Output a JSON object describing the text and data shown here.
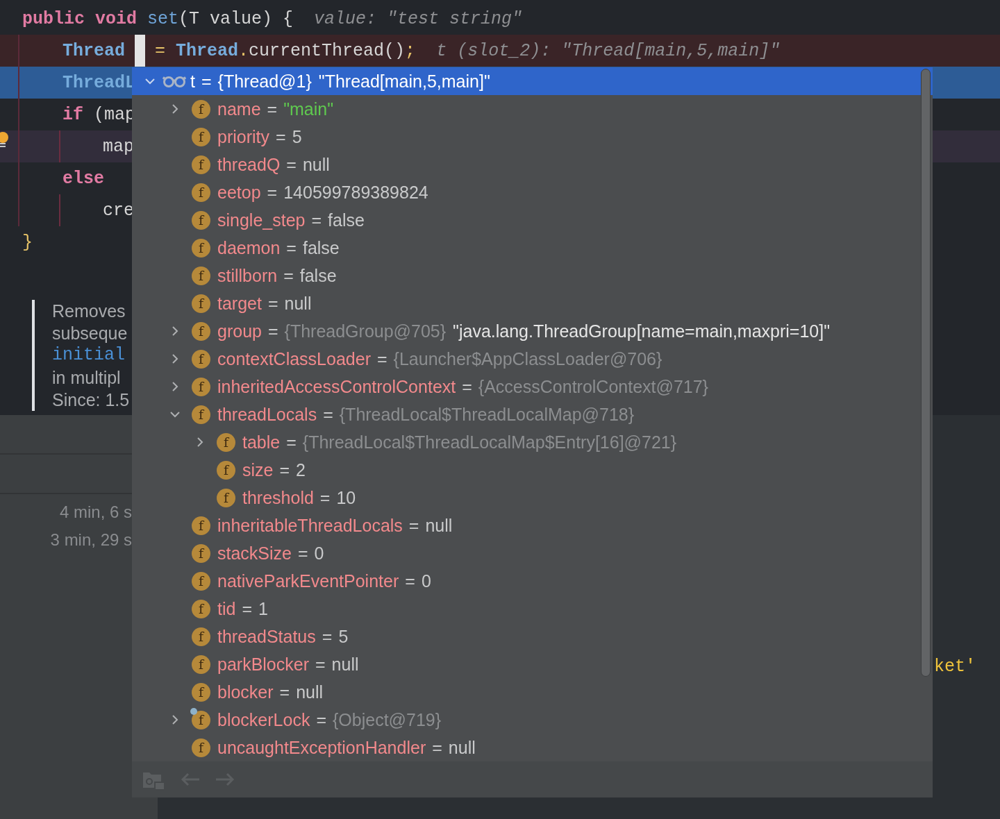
{
  "editor": {
    "lines": [
      {
        "kind": "normal",
        "bulb": false,
        "tokens": [
          {
            "kind": "keyword",
            "text": "public void "
          },
          {
            "kind": "method",
            "text": "set"
          },
          {
            "kind": "plain",
            "text": "(T value) {"
          },
          {
            "kind": "hint",
            "text": "value: \"test string\""
          }
        ],
        "children": [
          {
            "kind": "error",
            "bulb": false,
            "tokens": [
              {
                "kind": "type",
                "text": "Thread"
              },
              {
                "kind": "caret"
              },
              {
                "kind": "punct",
                "text": "= "
              },
              {
                "kind": "type",
                "text": "Thread"
              },
              {
                "kind": "punct",
                "text": "."
              },
              {
                "kind": "plain",
                "text": "currentThread()"
              },
              {
                "kind": "punct",
                "text": ";"
              },
              {
                "kind": "hint",
                "text": "t (slot_2): \"Thread[main,5,main]\""
              }
            ]
          },
          {
            "kind": "current",
            "bulb": false,
            "tokens": [
              {
                "kind": "type",
                "text": "ThreadL"
              }
            ]
          },
          {
            "kind": "normal",
            "bulb": false,
            "tokens": [
              {
                "kind": "keyword",
                "text": "if "
              },
              {
                "kind": "plain",
                "text": "(map"
              }
            ],
            "children": [
              {
                "kind": "highlight",
                "bulb": true,
                "tokens": [
                  {
                    "kind": "plain",
                    "text": "map"
                  }
                ]
              }
            ]
          },
          {
            "kind": "normal",
            "bulb": false,
            "tokens": [
              {
                "kind": "keyword",
                "text": "else"
              }
            ],
            "children": [
              {
                "kind": "normal",
                "bulb": false,
                "tokens": [
                  {
                    "kind": "plain",
                    "text": "cre"
                  }
                ]
              }
            ]
          }
        ]
      },
      {
        "kind": "normal",
        "bulb": false,
        "tokens": [
          {
            "kind": "punct",
            "text": "}"
          }
        ]
      }
    ]
  },
  "doc": {
    "lines": [
      {
        "kind": "text",
        "text": "Removes"
      },
      {
        "kind": "text",
        "text": "subseque"
      },
      {
        "kind": "code",
        "text": "initial"
      },
      {
        "kind": "text",
        "text": "in multipl"
      },
      {
        "kind": "text",
        "text": "Since: 1.5"
      }
    ]
  },
  "panel": {
    "rows": [
      "4 min, 6 s",
      "3 min, 29 s"
    ]
  },
  "right_code": {
    "text": "ket'"
  },
  "popup": {
    "root": {
      "name": "t",
      "op": "=",
      "ref": "{Thread@1}",
      "value": "\"Thread[main,5,main]\"",
      "kind": "watch",
      "selected": true,
      "expandable": true,
      "expanded": true,
      "pinned": false,
      "children": [
        {
          "icon": "f",
          "name": "name",
          "op": "=",
          "value": "\"main\"",
          "kind": "string",
          "selected": false,
          "expandable": true,
          "expanded": false,
          "pinned": false
        },
        {
          "icon": "f",
          "name": "priority",
          "op": "=",
          "value": "5",
          "kind": "primitive",
          "selected": false,
          "expandable": false,
          "expanded": false,
          "pinned": false
        },
        {
          "icon": "f",
          "name": "threadQ",
          "op": "=",
          "value": "null",
          "kind": "primitive",
          "selected": false,
          "expandable": false,
          "expanded": false,
          "pinned": false
        },
        {
          "icon": "f",
          "name": "eetop",
          "op": "=",
          "value": "140599789389824",
          "kind": "primitive",
          "selected": false,
          "expandable": false,
          "expanded": false,
          "pinned": false
        },
        {
          "icon": "f",
          "name": "single_step",
          "op": "=",
          "value": "false",
          "kind": "primitive",
          "selected": false,
          "expandable": false,
          "expanded": false,
          "pinned": false
        },
        {
          "icon": "f",
          "name": "daemon",
          "op": "=",
          "value": "false",
          "kind": "primitive",
          "selected": false,
          "expandable": false,
          "expanded": false,
          "pinned": false
        },
        {
          "icon": "f",
          "name": "stillborn",
          "op": "=",
          "value": "false",
          "kind": "primitive",
          "selected": false,
          "expandable": false,
          "expanded": false,
          "pinned": false
        },
        {
          "icon": "f",
          "name": "target",
          "op": "=",
          "value": "null",
          "kind": "primitive",
          "selected": false,
          "expandable": false,
          "expanded": false,
          "pinned": false
        },
        {
          "icon": "f",
          "name": "group",
          "op": "=",
          "ref": "{ThreadGroup@705}",
          "value": "\"java.lang.ThreadGroup[name=main,maxpri=10]\"",
          "kind": "object",
          "selected": false,
          "expandable": true,
          "expanded": false,
          "pinned": false
        },
        {
          "icon": "f",
          "name": "contextClassLoader",
          "op": "=",
          "ref": "{Launcher$AppClassLoader@706}",
          "kind": "object",
          "selected": false,
          "expandable": true,
          "expanded": false,
          "pinned": false
        },
        {
          "icon": "f",
          "name": "inheritedAccessControlContext",
          "op": "=",
          "ref": "{AccessControlContext@717}",
          "kind": "object",
          "selected": false,
          "expandable": true,
          "expanded": false,
          "pinned": false
        },
        {
          "icon": "f",
          "name": "threadLocals",
          "op": "=",
          "ref": "{ThreadLocal$ThreadLocalMap@718}",
          "kind": "object",
          "selected": false,
          "expandable": true,
          "expanded": true,
          "pinned": false,
          "children": [
            {
              "icon": "f",
              "name": "table",
              "op": "=",
              "ref": "{ThreadLocal$ThreadLocalMap$Entry[16]@721}",
              "kind": "object",
              "selected": false,
              "expandable": true,
              "expanded": false,
              "pinned": false
            },
            {
              "icon": "f",
              "name": "size",
              "op": "=",
              "value": "2",
              "kind": "primitive",
              "selected": false,
              "expandable": false,
              "expanded": false,
              "pinned": false
            },
            {
              "icon": "f",
              "name": "threshold",
              "op": "=",
              "value": "10",
              "kind": "primitive",
              "selected": false,
              "expandable": false,
              "expanded": false,
              "pinned": false
            }
          ]
        },
        {
          "icon": "f",
          "name": "inheritableThreadLocals",
          "op": "=",
          "value": "null",
          "kind": "primitive",
          "selected": false,
          "expandable": false,
          "expanded": false,
          "pinned": false
        },
        {
          "icon": "f",
          "name": "stackSize",
          "op": "=",
          "value": "0",
          "kind": "primitive",
          "selected": false,
          "expandable": false,
          "expanded": false,
          "pinned": false
        },
        {
          "icon": "f",
          "name": "nativeParkEventPointer",
          "op": "=",
          "value": "0",
          "kind": "primitive",
          "selected": false,
          "expandable": false,
          "expanded": false,
          "pinned": false
        },
        {
          "icon": "f",
          "name": "tid",
          "op": "=",
          "value": "1",
          "kind": "primitive",
          "selected": false,
          "expandable": false,
          "expanded": false,
          "pinned": false
        },
        {
          "icon": "f",
          "name": "threadStatus",
          "op": "=",
          "value": "5",
          "kind": "primitive",
          "selected": false,
          "expandable": false,
          "expanded": false,
          "pinned": false
        },
        {
          "icon": "f",
          "name": "parkBlocker",
          "op": "=",
          "value": "null",
          "kind": "primitive",
          "selected": false,
          "expandable": false,
          "expanded": false,
          "pinned": false
        },
        {
          "icon": "f",
          "name": "blocker",
          "op": "=",
          "value": "null",
          "kind": "primitive",
          "selected": false,
          "expandable": false,
          "expanded": false,
          "pinned": false
        },
        {
          "icon": "f",
          "name": "blockerLock",
          "op": "=",
          "ref": "{Object@719}",
          "kind": "object",
          "selected": false,
          "expandable": true,
          "expanded": false,
          "pinned": true
        },
        {
          "icon": "f",
          "name": "uncaughtExceptionHandler",
          "op": "=",
          "value": "null",
          "kind": "primitive",
          "selected": false,
          "expandable": false,
          "expanded": false,
          "pinned": false
        }
      ]
    }
  }
}
